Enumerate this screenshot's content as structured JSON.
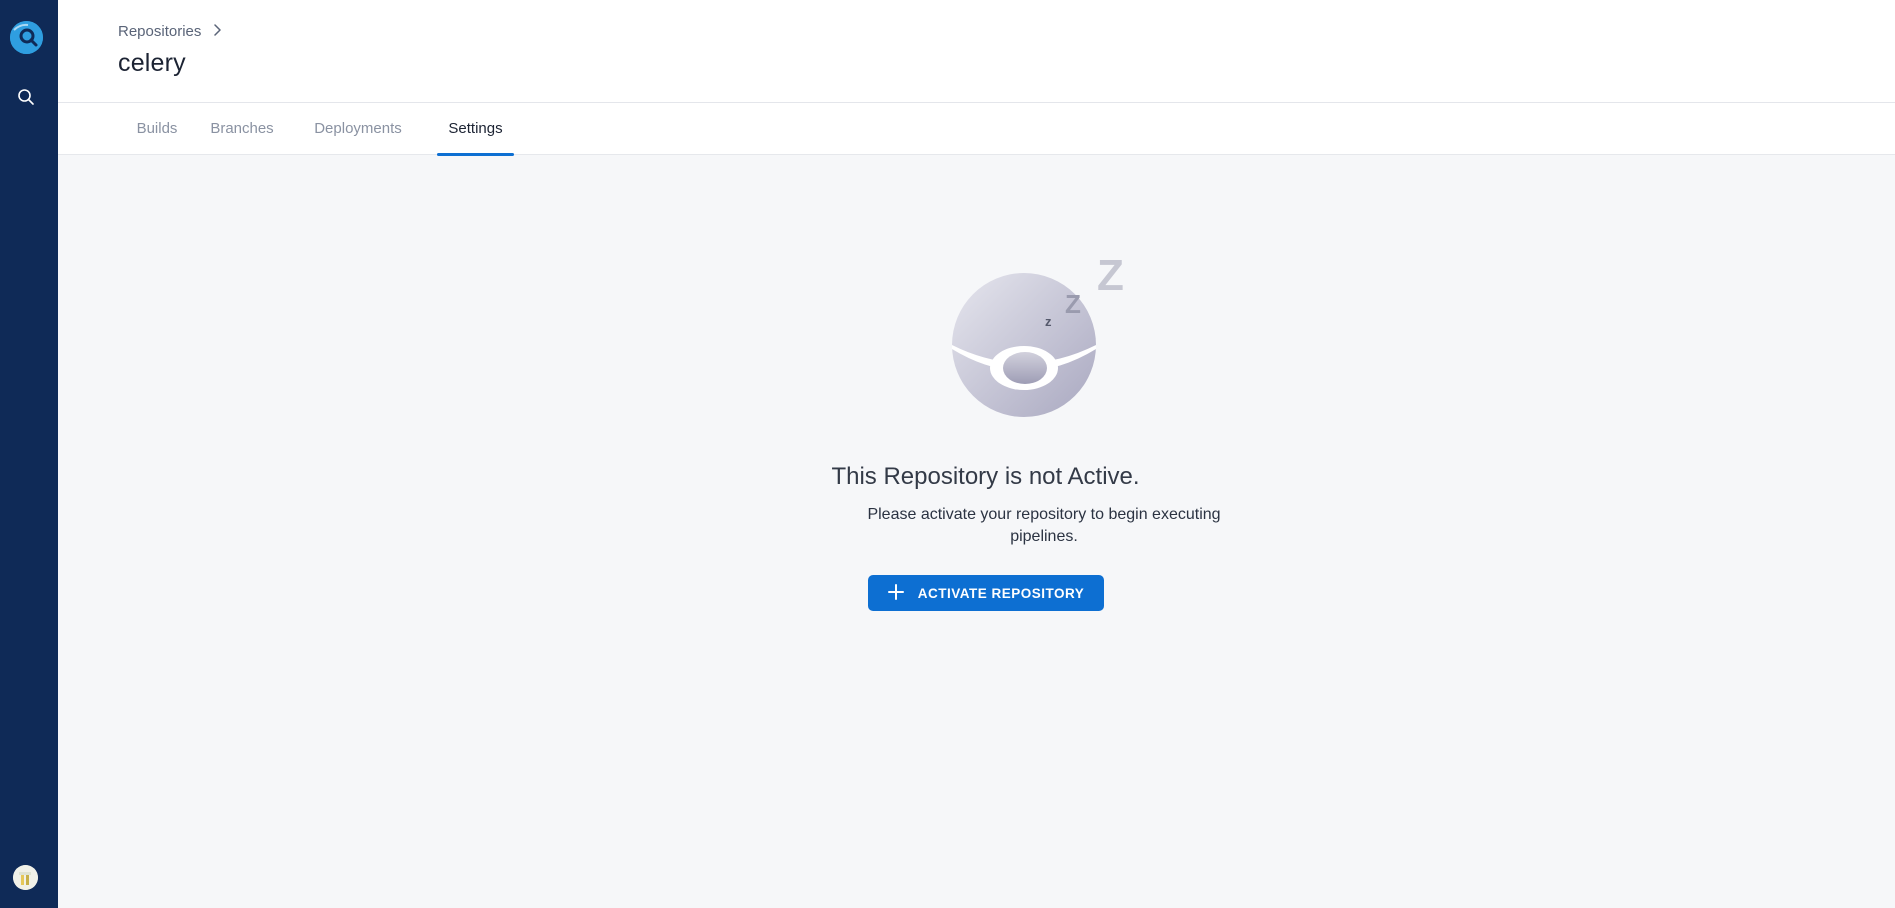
{
  "sidebar": {
    "logo_icon": "app-logo-icon",
    "search_icon": "search-icon",
    "avatar_icon": "user-avatar"
  },
  "header": {
    "breadcrumb": {
      "label": "Repositories"
    },
    "title": "celery"
  },
  "tabs": [
    {
      "label": "Builds",
      "active": false
    },
    {
      "label": "Branches",
      "active": false
    },
    {
      "label": "Deployments",
      "active": false
    },
    {
      "label": "Settings",
      "active": true
    }
  ],
  "empty_state": {
    "illustration_icon": "sleeping-icon",
    "title": "This Repository is not Active.",
    "description": "Please activate your repository to begin executing pipelines.",
    "button_label": "ACTIVATE REPOSITORY",
    "button_icon": "plus-icon"
  },
  "colors": {
    "sidebar": "#0f2a57",
    "accent": "#0d6fd2",
    "background": "#f6f7f9"
  }
}
